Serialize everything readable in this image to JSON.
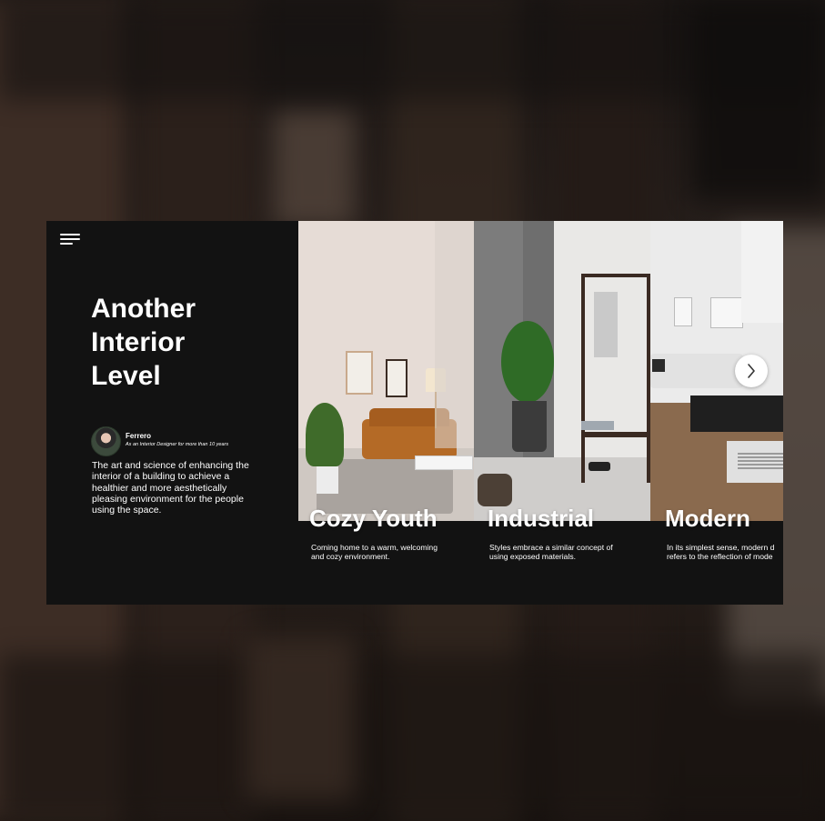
{
  "colors": {
    "card_background": "#121212",
    "text": "#ffffff",
    "backdrop": "#1d1714"
  },
  "menu": {
    "icon": "menu-lines-icon"
  },
  "hero": {
    "title_line1": "Another",
    "title_line2": "Interior",
    "title_line3": "Level"
  },
  "author": {
    "name": "Ferrero",
    "role": "As an Interior Designer for more than 10 years"
  },
  "description": {
    "line1": "The art and science of enhancing the",
    "line2": "interior of a building to achieve a",
    "line3": "healthier and more aesthetically",
    "line4": "pleasing environment for the people",
    "line5": "using the space."
  },
  "styles": [
    {
      "title": "Cozy Youth",
      "caption_line1": "Coming home to a warm, welcoming",
      "caption_line2": "and cozy environment."
    },
    {
      "title": "Industrial",
      "caption_line1": "Styles embrace a similar concept of",
      "caption_line2": "using exposed materials."
    },
    {
      "title": "Modern",
      "caption_line1": "In its simplest sense, modern d",
      "caption_line2": "refers to the reflection of mode"
    }
  ],
  "carousel": {
    "next_icon": "chevron-right-icon"
  }
}
